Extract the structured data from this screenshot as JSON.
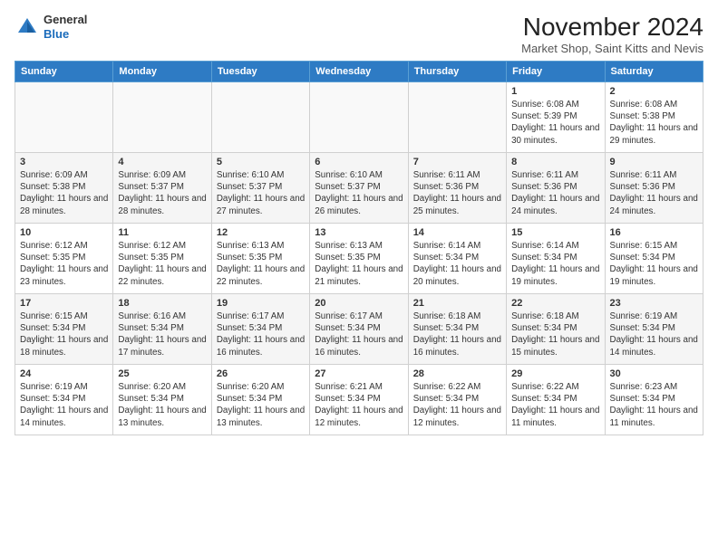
{
  "logo": {
    "general": "General",
    "blue": "Blue"
  },
  "header": {
    "title": "November 2024",
    "subtitle": "Market Shop, Saint Kitts and Nevis"
  },
  "weekdays": [
    "Sunday",
    "Monday",
    "Tuesday",
    "Wednesday",
    "Thursday",
    "Friday",
    "Saturday"
  ],
  "weeks": [
    [
      {
        "day": "",
        "info": ""
      },
      {
        "day": "",
        "info": ""
      },
      {
        "day": "",
        "info": ""
      },
      {
        "day": "",
        "info": ""
      },
      {
        "day": "",
        "info": ""
      },
      {
        "day": "1",
        "info": "Sunrise: 6:08 AM\nSunset: 5:39 PM\nDaylight: 11 hours and 30 minutes."
      },
      {
        "day": "2",
        "info": "Sunrise: 6:08 AM\nSunset: 5:38 PM\nDaylight: 11 hours and 29 minutes."
      }
    ],
    [
      {
        "day": "3",
        "info": "Sunrise: 6:09 AM\nSunset: 5:38 PM\nDaylight: 11 hours and 28 minutes."
      },
      {
        "day": "4",
        "info": "Sunrise: 6:09 AM\nSunset: 5:37 PM\nDaylight: 11 hours and 28 minutes."
      },
      {
        "day": "5",
        "info": "Sunrise: 6:10 AM\nSunset: 5:37 PM\nDaylight: 11 hours and 27 minutes."
      },
      {
        "day": "6",
        "info": "Sunrise: 6:10 AM\nSunset: 5:37 PM\nDaylight: 11 hours and 26 minutes."
      },
      {
        "day": "7",
        "info": "Sunrise: 6:11 AM\nSunset: 5:36 PM\nDaylight: 11 hours and 25 minutes."
      },
      {
        "day": "8",
        "info": "Sunrise: 6:11 AM\nSunset: 5:36 PM\nDaylight: 11 hours and 24 minutes."
      },
      {
        "day": "9",
        "info": "Sunrise: 6:11 AM\nSunset: 5:36 PM\nDaylight: 11 hours and 24 minutes."
      }
    ],
    [
      {
        "day": "10",
        "info": "Sunrise: 6:12 AM\nSunset: 5:35 PM\nDaylight: 11 hours and 23 minutes."
      },
      {
        "day": "11",
        "info": "Sunrise: 6:12 AM\nSunset: 5:35 PM\nDaylight: 11 hours and 22 minutes."
      },
      {
        "day": "12",
        "info": "Sunrise: 6:13 AM\nSunset: 5:35 PM\nDaylight: 11 hours and 22 minutes."
      },
      {
        "day": "13",
        "info": "Sunrise: 6:13 AM\nSunset: 5:35 PM\nDaylight: 11 hours and 21 minutes."
      },
      {
        "day": "14",
        "info": "Sunrise: 6:14 AM\nSunset: 5:34 PM\nDaylight: 11 hours and 20 minutes."
      },
      {
        "day": "15",
        "info": "Sunrise: 6:14 AM\nSunset: 5:34 PM\nDaylight: 11 hours and 19 minutes."
      },
      {
        "day": "16",
        "info": "Sunrise: 6:15 AM\nSunset: 5:34 PM\nDaylight: 11 hours and 19 minutes."
      }
    ],
    [
      {
        "day": "17",
        "info": "Sunrise: 6:15 AM\nSunset: 5:34 PM\nDaylight: 11 hours and 18 minutes."
      },
      {
        "day": "18",
        "info": "Sunrise: 6:16 AM\nSunset: 5:34 PM\nDaylight: 11 hours and 17 minutes."
      },
      {
        "day": "19",
        "info": "Sunrise: 6:17 AM\nSunset: 5:34 PM\nDaylight: 11 hours and 16 minutes."
      },
      {
        "day": "20",
        "info": "Sunrise: 6:17 AM\nSunset: 5:34 PM\nDaylight: 11 hours and 16 minutes."
      },
      {
        "day": "21",
        "info": "Sunrise: 6:18 AM\nSunset: 5:34 PM\nDaylight: 11 hours and 16 minutes."
      },
      {
        "day": "22",
        "info": "Sunrise: 6:18 AM\nSunset: 5:34 PM\nDaylight: 11 hours and 15 minutes."
      },
      {
        "day": "23",
        "info": "Sunrise: 6:19 AM\nSunset: 5:34 PM\nDaylight: 11 hours and 14 minutes."
      }
    ],
    [
      {
        "day": "24",
        "info": "Sunrise: 6:19 AM\nSunset: 5:34 PM\nDaylight: 11 hours and 14 minutes."
      },
      {
        "day": "25",
        "info": "Sunrise: 6:20 AM\nSunset: 5:34 PM\nDaylight: 11 hours and 13 minutes."
      },
      {
        "day": "26",
        "info": "Sunrise: 6:20 AM\nSunset: 5:34 PM\nDaylight: 11 hours and 13 minutes."
      },
      {
        "day": "27",
        "info": "Sunrise: 6:21 AM\nSunset: 5:34 PM\nDaylight: 11 hours and 12 minutes."
      },
      {
        "day": "28",
        "info": "Sunrise: 6:22 AM\nSunset: 5:34 PM\nDaylight: 11 hours and 12 minutes."
      },
      {
        "day": "29",
        "info": "Sunrise: 6:22 AM\nSunset: 5:34 PM\nDaylight: 11 hours and 11 minutes."
      },
      {
        "day": "30",
        "info": "Sunrise: 6:23 AM\nSunset: 5:34 PM\nDaylight: 11 hours and 11 minutes."
      }
    ]
  ]
}
